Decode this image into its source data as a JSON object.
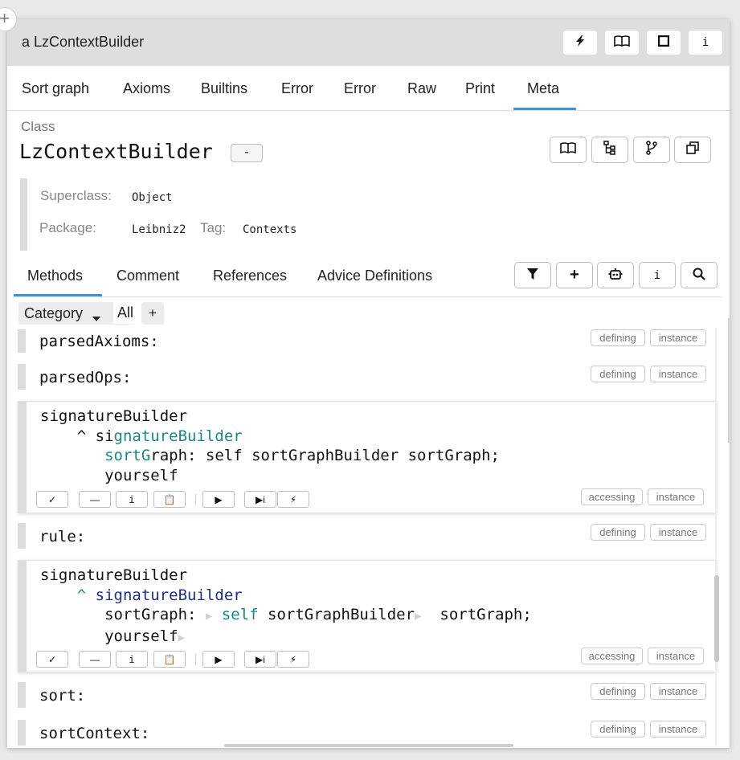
{
  "window": {
    "title": "a LzContextBuilder",
    "title_buttons": [
      {
        "icon": "lightning-icon",
        "glyph": "⚡"
      },
      {
        "icon": "book-icon",
        "glyph": "📖"
      },
      {
        "icon": "square-icon",
        "glyph": "■"
      },
      {
        "icon": "info-icon",
        "glyph": "i"
      }
    ]
  },
  "tabs": [
    {
      "label": "Sort graph"
    },
    {
      "label": "Axioms"
    },
    {
      "label": "Builtins"
    },
    {
      "label": "Error"
    },
    {
      "label": "Error"
    },
    {
      "label": "Raw"
    },
    {
      "label": "Print"
    },
    {
      "label": "Meta",
      "active": true
    }
  ],
  "class_pane": {
    "label": "Class",
    "name": "LzContextBuilder",
    "minus": "-",
    "superclass_label": "Superclass:",
    "superclass": "Object",
    "package_label": "Package:",
    "package": "Leibniz2",
    "tag_label": "Tag:",
    "tag": "Contexts"
  },
  "method_tabs": [
    {
      "label": "Methods",
      "active": true
    },
    {
      "label": "Comment"
    },
    {
      "label": "References"
    },
    {
      "label": "Advice Definitions"
    }
  ],
  "filter": {
    "category_label": "Category",
    "all_label": "All",
    "plus_label": "+"
  },
  "methods": [
    {
      "selector": "parsedAxioms:",
      "protocol": "defining",
      "side": "instance"
    },
    {
      "selector": "parsedOps:",
      "protocol": "defining",
      "side": "instance"
    },
    {
      "selector": "signatureBuilder",
      "protocol": "accessing",
      "side": "instance",
      "expanded": true
    },
    {
      "selector": "rule:",
      "protocol": "defining",
      "side": "instance"
    },
    {
      "selector": "signatureBuilder",
      "protocol": "accessing",
      "side": "instance",
      "expanded": true
    },
    {
      "selector": "sort:",
      "protocol": "defining",
      "side": "instance"
    },
    {
      "selector": "sortContext:",
      "protocol": "defining",
      "side": "instance"
    }
  ],
  "code": {
    "caret": "^",
    "sig_plain": "signatureBuilder",
    "sortGraph_kw": "sortGraph:",
    "self_kw": "self",
    "sortGraphBuilder": "sortGraphBuilder",
    "sortGraph_unary": "sortGraph;",
    "yourself": "yourself"
  },
  "colors": {
    "accent": "#3a96d8",
    "teal": "#148a8a",
    "navy": "#1a2f8c"
  }
}
